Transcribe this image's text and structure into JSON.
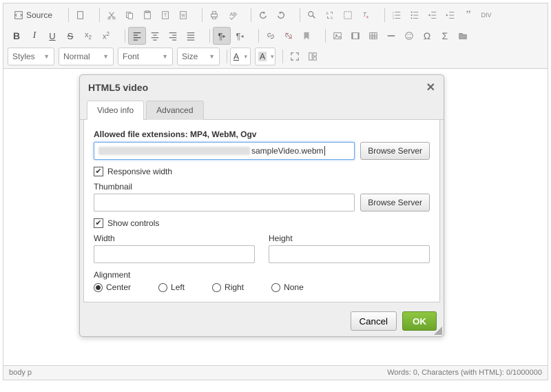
{
  "toolbar": {
    "source_label": "Source",
    "styles_label": "Styles",
    "format_label": "Normal",
    "font_label": "Font",
    "size_label": "Size"
  },
  "dialog": {
    "title": "HTML5 video",
    "tabs": {
      "video_info": "Video info",
      "advanced": "Advanced"
    },
    "allowed_ext_label": "Allowed file extensions: MP4, WebM, Ogv",
    "url_visible_suffix": "sampleVideo.webm",
    "browse_server": "Browse Server",
    "responsive_width": "Responsive width",
    "thumbnail": "Thumbnail",
    "thumbnail_value": "",
    "show_controls": "Show controls",
    "width_label": "Width",
    "width_value": "",
    "height_label": "Height",
    "height_value": "",
    "alignment_label": "Alignment",
    "align": {
      "center": "Center",
      "left": "Left",
      "right": "Right",
      "none": "None"
    },
    "cancel": "Cancel",
    "ok": "OK",
    "responsive_checked": true,
    "controls_checked": true,
    "alignment_selected": "center"
  },
  "status": {
    "path": "body   p",
    "words": "Words: 0, Characters (with HTML): 0/1000000"
  }
}
